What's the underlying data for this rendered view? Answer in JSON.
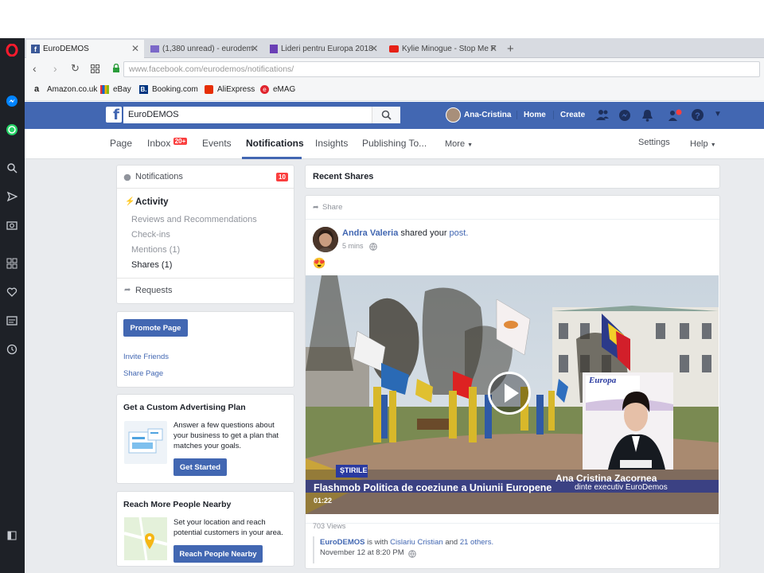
{
  "browser": {
    "tabs": [
      {
        "title": "EuroDEMOS",
        "favicon_color": "#3b5998"
      },
      {
        "title": "(1,380 unread) - eurodem",
        "favicon_color": "#7b68c8"
      },
      {
        "title": "Lideri pentru Europa 2018",
        "favicon_color": "#6a3fb5"
      },
      {
        "title": "Kylie Minogue - Stop Me F",
        "favicon_color": "#e62117"
      }
    ],
    "new_tab": "+",
    "url_host": "www.facebook.com",
    "url_path": "/eurodemos/notifications/",
    "bookmarks": [
      "Amazon.co.uk",
      "eBay",
      "Booking.com",
      "AliExpress",
      "eMAG"
    ]
  },
  "facebook": {
    "search_value": "EuroDEMOS",
    "user_name": "Ana-Cristina",
    "nav_home": "Home",
    "nav_create": "Create"
  },
  "page_nav": {
    "items": [
      "Page",
      "Inbox",
      "Events",
      "Notifications",
      "Insights",
      "Publishing To...",
      "More"
    ],
    "inbox_badge": "20+",
    "settings": "Settings",
    "help": "Help"
  },
  "left": {
    "notifications_label": "Notifications",
    "notifications_count": "10",
    "activity_label": "Activity",
    "activity_items": [
      "Reviews and Recommendations",
      "Check-ins",
      "Mentions (1)",
      "Shares (1)"
    ],
    "requests_label": "Requests",
    "promote_button": "Promote Page",
    "invite_friends": "Invite Friends",
    "share_page": "Share Page",
    "ad_plan": {
      "title": "Get a Custom Advertising Plan",
      "body": "Answer a few questions about your business to get a plan that matches your goals.",
      "button": "Get Started"
    },
    "reach": {
      "title": "Reach More People Nearby",
      "body": "Set your location and reach potential customers in your area.",
      "button": "Reach People Nearby"
    }
  },
  "main": {
    "header": "Recent Shares",
    "share_label": "Share",
    "post": {
      "author": "Andra Valeria",
      "action": "shared your",
      "object": "post.",
      "time": "5 mins",
      "emoji": "😍",
      "video": {
        "caption_name": "Ana Cristina Zacornea",
        "caption_role": "dinte executiv EuroDemos",
        "title": "Flashmob Politica de coeziune a Uniunii Europene",
        "duration": "01:22",
        "station": "ȘTIRILE",
        "sign_text": "Europa"
      },
      "views": "703 Views",
      "shared_by": "EuroDEMOS",
      "is_with": "is with",
      "tagged": "Cislariu Cristian",
      "and": "and",
      "others": "21 others.",
      "date": "November 12 at 8:20 PM"
    }
  }
}
